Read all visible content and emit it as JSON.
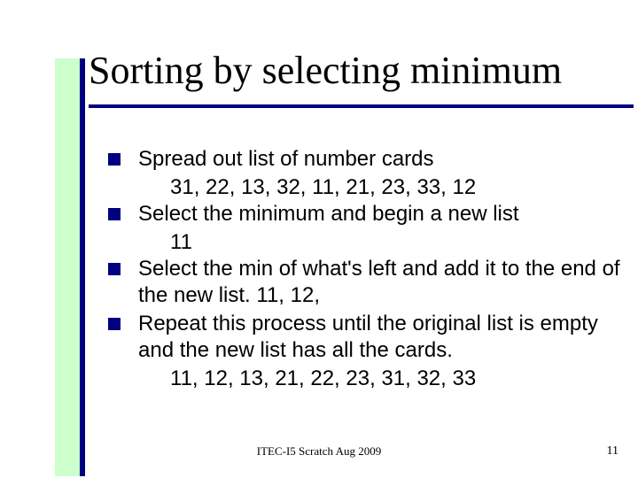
{
  "title": "Sorting by selecting minimum",
  "bullets": [
    {
      "text": "Spread out list of number cards",
      "sub": "31, 22, 13, 32, 11, 21, 23, 33, 12"
    },
    {
      "text": "Select the minimum and begin a new list",
      "sub": "11"
    },
    {
      "text": "Select the min of what's left and add it to the end of the new list.   11, 12,",
      "sub": null
    },
    {
      "text": "Repeat this process until the original list is empty and the new list has all the cards.",
      "sub": "11, 12, 13, 21, 22, 23, 31, 32, 33"
    }
  ],
  "footer": "ITEC-I5 Scratch Aug 2009",
  "page_number": "11"
}
